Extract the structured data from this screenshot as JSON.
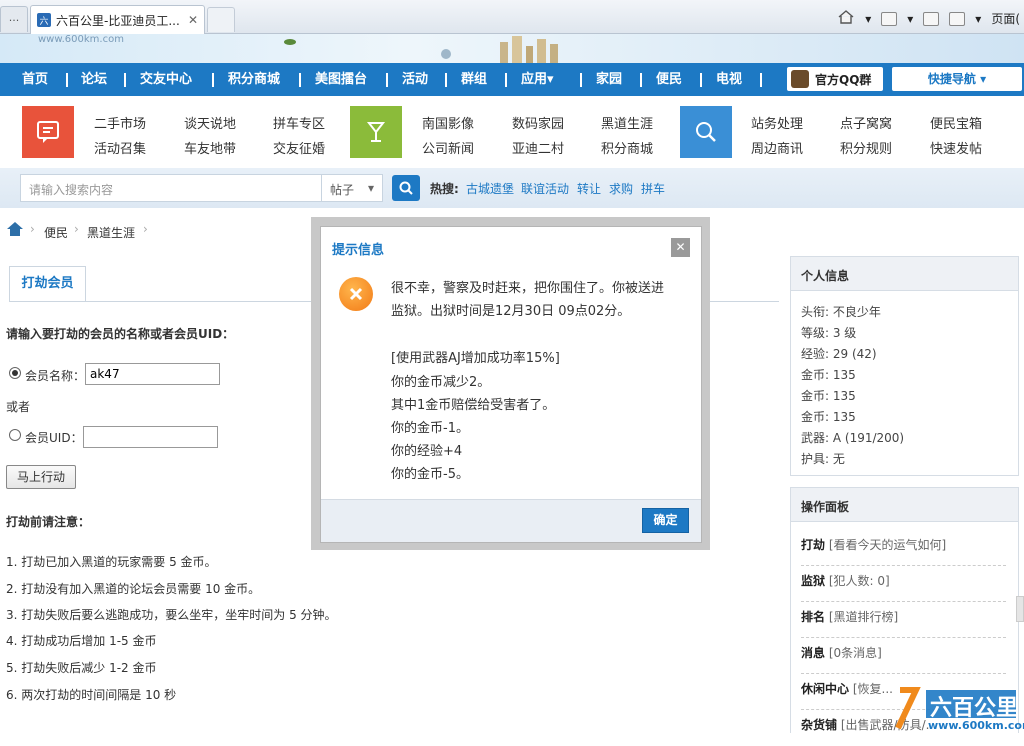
{
  "browser": {
    "tab_small_label": "...",
    "tab_title": "六百公里-比亚迪员工...",
    "tab_close": "✕",
    "page_menu": "页面("
  },
  "banner": {
    "url": "www.600km.com"
  },
  "nav": {
    "items": [
      "首页",
      "论坛",
      "交友中心",
      "积分商城",
      "美图擂台",
      "活动",
      "群组",
      "应用▾",
      "家园",
      "便民",
      "电视"
    ],
    "qq_group": "官方QQ群",
    "quick_nav": "快捷导航 ▾"
  },
  "categories": {
    "group1": [
      "二手市场",
      "谈天说地",
      "拼车专区",
      "活动召集",
      "车友地带",
      "交友征婚"
    ],
    "group2": [
      "南国影像",
      "数码家园",
      "黑道生涯",
      "公司新闻",
      "亚迪二村",
      "积分商城"
    ],
    "group3": [
      "站务处理",
      "点子窝窝",
      "便民宝箱",
      "周边商讯",
      "积分规则",
      "快速发帖"
    ]
  },
  "search": {
    "placeholder": "请输入搜索内容",
    "type": "帖子",
    "hot_label": "热搜:",
    "hot_links": [
      "古城遗堡",
      "联谊活动",
      "转让",
      "求购",
      "拼车"
    ]
  },
  "breadcrumb": [
    "便民",
    "黑道生涯"
  ],
  "rob": {
    "tab": "打劫会员",
    "prompt": "请输入要打劫的会员的名称或者会员UID：",
    "name_label": "会员名称：",
    "name_value": "ak47",
    "or": "或者",
    "uid_label": "会员UID：",
    "uid_value": "",
    "action_button": "马上行动",
    "notes_title": "打劫前请注意：",
    "notes": [
      "1. 打劫已加入黑道的玩家需要 5 金币。",
      "2. 打劫没有加入黑道的论坛会员需要 10 金币。",
      "3. 打劫失败后要么逃跑成功，要么坐牢，坐牢时间为 5 分钟。",
      "4. 打劫成功后增加 1-5 金币",
      "5. 打劫失败后减少 1-2 金币",
      "6. 两次打劫的时间间隔是 10 秒"
    ]
  },
  "modal": {
    "title": "提示信息",
    "close": "✕",
    "lines": [
      "很不幸，警察及时赶来，把你围住了。你被送进",
      "监狱。出狱时间是12月30日 09点02分。",
      "[使用武器AJ增加成功率15%]",
      "你的金币减少2。",
      "其中1金币赔偿给受害者了。",
      "你的金币-1。",
      "你的经验+4",
      "你的金币-5。"
    ],
    "ok": "确定"
  },
  "personal": {
    "title": "个人信息",
    "lines": [
      "头衔: 不良少年",
      "等级: 3 级",
      "经验: 29 (42)",
      "金币: 135",
      "金币: 135",
      "金币: 135",
      "武器: A (191/200)",
      "护具: 无"
    ]
  },
  "ops": {
    "title": "操作面板",
    "rows": [
      {
        "name": "打劫",
        "desc": "[看看今天的运气如何]"
      },
      {
        "name": "监狱",
        "desc": "[犯人数: 0]"
      },
      {
        "name": "排名",
        "desc": "[黑道排行榜]"
      },
      {
        "name": "消息",
        "desc": "[0条消息]"
      },
      {
        "name": "休闲中心",
        "desc": "[恢复..."
      },
      {
        "name": "杂货铺",
        "desc": "[出售武器/防具/..."
      }
    ]
  },
  "watermark": {
    "brand": "六百公里",
    "url": "www.600km.com"
  },
  "colors": {
    "nav_blue": "#1d79c4",
    "cat_red": "#e8533b",
    "cat_green": "#8bbb3a",
    "cat_blue": "#3a8fd6",
    "error_orange": "#f27a16"
  }
}
